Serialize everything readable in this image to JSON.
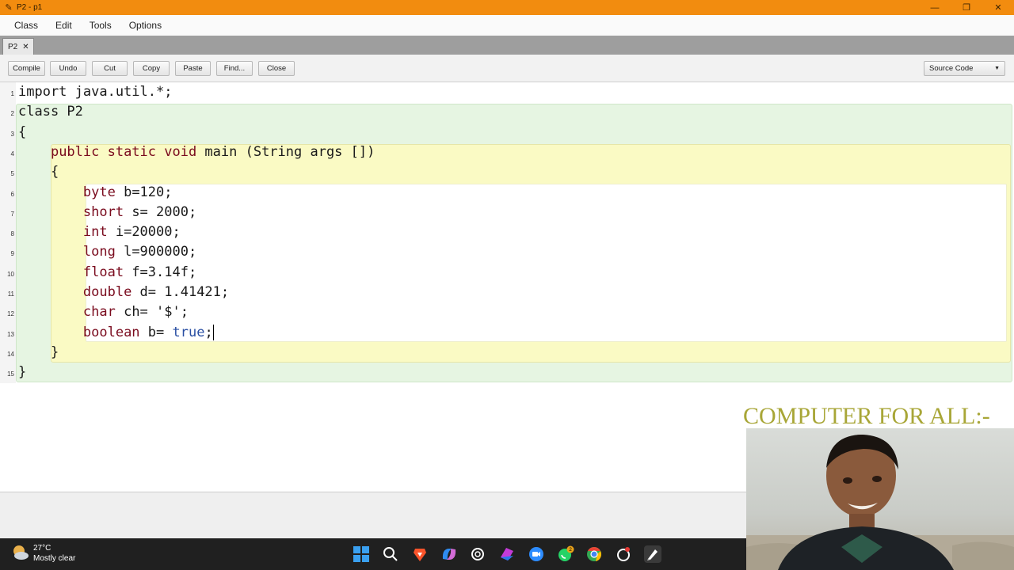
{
  "window": {
    "title": "P2 - p1",
    "controls": {
      "minimize": "—",
      "restore": "❐",
      "close": "✕"
    }
  },
  "menu": [
    "Class",
    "Edit",
    "Tools",
    "Options"
  ],
  "tab": {
    "label": "P2",
    "close": "✕"
  },
  "toolbar": {
    "buttons": [
      "Compile",
      "Undo",
      "Cut",
      "Copy",
      "Paste",
      "Find...",
      "Close"
    ],
    "view_select": "Source Code"
  },
  "editor": {
    "line_numbers": [
      "1",
      "2",
      "3",
      "4",
      "5",
      "6",
      "7",
      "8",
      "9",
      "10",
      "11",
      "12",
      "13",
      "14",
      "15"
    ],
    "lines": [
      [
        {
          "t": "import java.util.*;"
        }
      ],
      [
        {
          "t": "class P2"
        }
      ],
      [
        {
          "t": "{"
        }
      ],
      [
        {
          "t": "    "
        },
        {
          "t": "public static void",
          "c": "kw"
        },
        {
          "t": " main (String args [])"
        }
      ],
      [
        {
          "t": "    {"
        }
      ],
      [
        {
          "t": "        "
        },
        {
          "t": "byte",
          "c": "kw"
        },
        {
          "t": " b=120;"
        }
      ],
      [
        {
          "t": "        "
        },
        {
          "t": "short",
          "c": "kw"
        },
        {
          "t": " s= 2000;"
        }
      ],
      [
        {
          "t": "        "
        },
        {
          "t": "int",
          "c": "kw"
        },
        {
          "t": " i=20000;"
        }
      ],
      [
        {
          "t": "        "
        },
        {
          "t": "long",
          "c": "kw"
        },
        {
          "t": " l=900000;"
        }
      ],
      [
        {
          "t": "        "
        },
        {
          "t": "float",
          "c": "kw"
        },
        {
          "t": " f=3.14f;"
        }
      ],
      [
        {
          "t": "        "
        },
        {
          "t": "double",
          "c": "kw"
        },
        {
          "t": " d= 1.41421;"
        }
      ],
      [
        {
          "t": "        "
        },
        {
          "t": "char",
          "c": "kw"
        },
        {
          "t": " ch= '$';"
        }
      ],
      [
        {
          "t": "        "
        },
        {
          "t": "boolean",
          "c": "kw"
        },
        {
          "t": " b= "
        },
        {
          "t": "true",
          "c": "lit"
        },
        {
          "t": ";"
        }
      ],
      [
        {
          "t": "    }"
        }
      ],
      [
        {
          "t": "}"
        }
      ]
    ],
    "caret_line": 13
  },
  "overlay": {
    "channel_text": "COMPUTER FOR ALL:-"
  },
  "taskbar": {
    "weather": {
      "temp": "27°C",
      "condition": "Mostly clear"
    },
    "icons": [
      "windows-start-icon",
      "search-icon",
      "brave-browser-icon",
      "copilot-icon",
      "chatgpt-icon",
      "microsoft-365-icon",
      "zoom-icon",
      "whatsapp-icon",
      "chrome-icon",
      "antivirus-icon",
      "bluej-icon"
    ],
    "badges": {
      "whatsapp": "2"
    }
  },
  "colors": {
    "titlebar": "#f28c0f",
    "class_scope": "#e6f5e2",
    "method_scope": "#fafac4",
    "block_scope": "#ffffff",
    "keyword": "#7a0b1e",
    "literal": "#2a4fa3",
    "watermark": "#a8a637"
  }
}
